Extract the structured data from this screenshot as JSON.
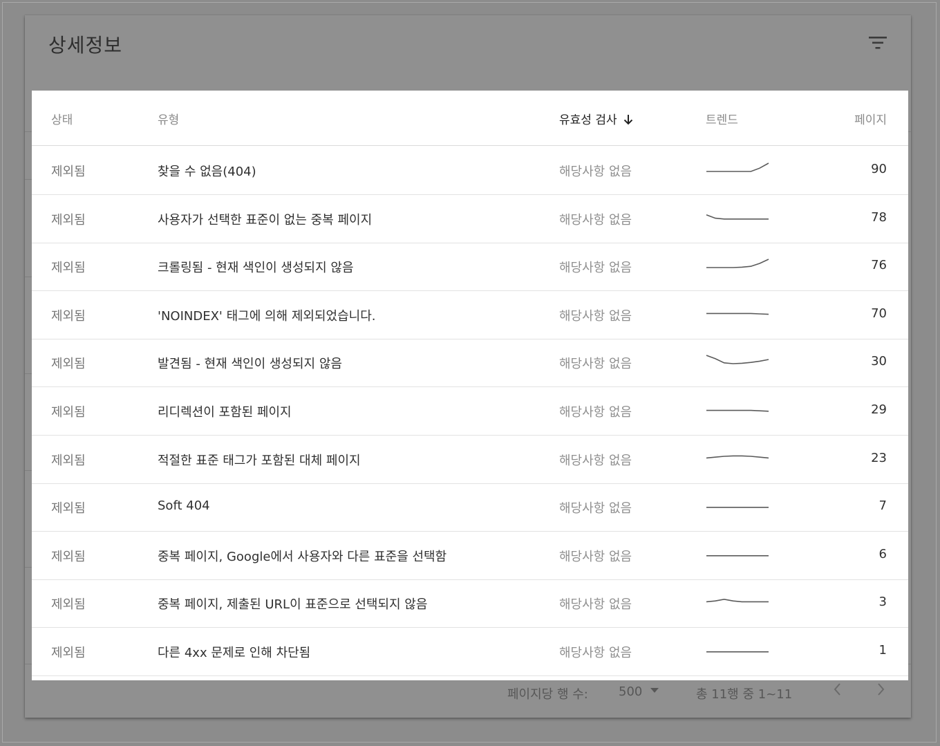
{
  "card": {
    "title": "상세정보",
    "filter_icon": "filter-icon"
  },
  "table": {
    "headers": {
      "status": "상태",
      "type": "유형",
      "validation": "유효성 검사",
      "trend": "트렌드",
      "pages": "페이지"
    },
    "sort_icon": "arrow-down-icon",
    "rows": [
      {
        "status": "제외됨",
        "type": "찾을 수 없음(404)",
        "validation": "해당사항 없음",
        "pages": "90",
        "trend": [
          0,
          0,
          0,
          0,
          0,
          0,
          0.4,
          1
        ]
      },
      {
        "status": "제외됨",
        "type": "사용자가 선택한 표준이 없는 중복 페이지",
        "validation": "해당사항 없음",
        "pages": "78",
        "trend": [
          0.6,
          0.2,
          0.1,
          0.1,
          0.1,
          0.1,
          0.1,
          0.1
        ]
      },
      {
        "status": "제외됨",
        "type": "크롤링됨 - 현재 색인이 생성되지 않음",
        "validation": "해당사항 없음",
        "pages": "76",
        "trend": [
          0,
          0,
          0,
          0,
          0.05,
          0.15,
          0.5,
          1
        ]
      },
      {
        "status": "제외됨",
        "type": "'NOINDEX' 태그에 의해 제외되었습니다.",
        "validation": "해당사항 없음",
        "pages": "70",
        "trend": [
          0.3,
          0.3,
          0.3,
          0.3,
          0.3,
          0.3,
          0.25,
          0.2
        ]
      },
      {
        "status": "제외됨",
        "type": "발견됨 - 현재 색인이 생성되지 않음",
        "validation": "해당사항 없음",
        "pages": "30",
        "trend": [
          1,
          0.6,
          0.1,
          0,
          0.05,
          0.15,
          0.3,
          0.5
        ]
      },
      {
        "status": "제외됨",
        "type": "리디렉션이 포함된 페이지",
        "validation": "해당사항 없음",
        "pages": "29",
        "trend": [
          0.2,
          0.2,
          0.2,
          0.2,
          0.2,
          0.2,
          0.15,
          0.1
        ]
      },
      {
        "status": "제외됨",
        "type": "적절한 표준 태그가 포함된 대체 페이지",
        "validation": "해당사항 없음",
        "pages": "23",
        "trend": [
          0.3,
          0.4,
          0.5,
          0.55,
          0.55,
          0.5,
          0.4,
          0.3
        ]
      },
      {
        "status": "제외됨",
        "type": "Soft 404",
        "validation": "해당사항 없음",
        "pages": "7",
        "trend": [
          0.1,
          0.1,
          0.1,
          0.1,
          0.1,
          0.1,
          0.1,
          0.1
        ]
      },
      {
        "status": "제외됨",
        "type": "중복 페이지, Google에서 사용자와 다른 표준을 선택함",
        "validation": "해당사항 없음",
        "pages": "6",
        "trend": [
          0.1,
          0.1,
          0.1,
          0.1,
          0.1,
          0.1,
          0.1,
          0.1
        ]
      },
      {
        "status": "제외됨",
        "type": "중복 페이지, 제출된 URL이 표준으로 선택되지 않음",
        "validation": "해당사항 없음",
        "pages": "3",
        "trend": [
          0.3,
          0.4,
          0.6,
          0.4,
          0.3,
          0.3,
          0.3,
          0.3
        ]
      },
      {
        "status": "제외됨",
        "type": "다른 4xx 문제로 인해 차단됨",
        "validation": "해당사항 없음",
        "pages": "1",
        "trend": [
          0.1,
          0.1,
          0.1,
          0.1,
          0.1,
          0.1,
          0.1,
          0.1
        ]
      }
    ]
  },
  "footer": {
    "rows_per_page_label": "페이지당 행 수:",
    "rows_per_page_value": "500",
    "range_label": "총 11행 중 1~11",
    "prev_icon": "chevron-left-icon",
    "next_icon": "chevron-right-icon"
  },
  "colors": {
    "overlay": "#8c8c8c",
    "panel": "#ffffff",
    "sparkline": "#5a5a5a"
  }
}
